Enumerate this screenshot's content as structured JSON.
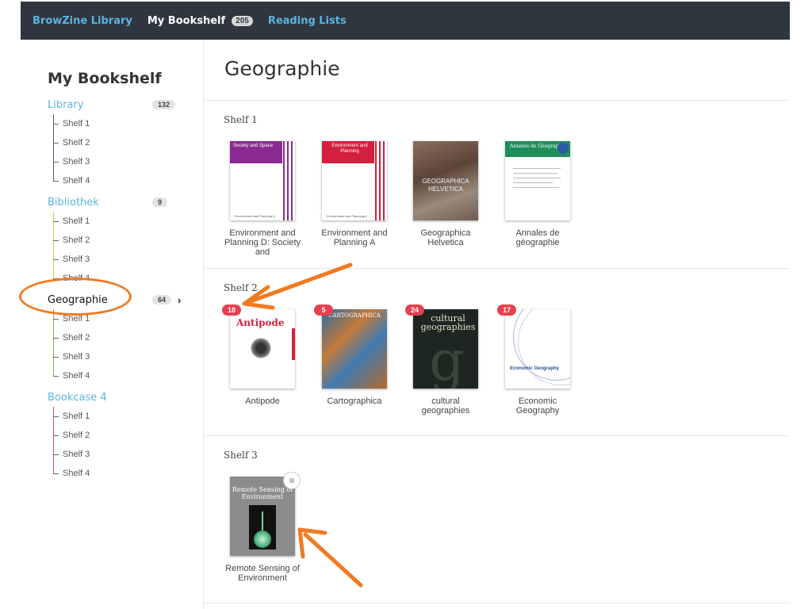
{
  "topbar": {
    "brand": "BrowZine Library",
    "my_bookshelf": "My Bookshelf",
    "my_bookshelf_count": "205",
    "reading_lists": "Reading Lists"
  },
  "sidebar": {
    "title": "My Bookshelf",
    "sections": [
      {
        "name": "Library",
        "count": "132",
        "shelves": [
          "Shelf 1",
          "Shelf 2",
          "Shelf 3",
          "Shelf 4"
        ]
      },
      {
        "name": "Bibliothek",
        "count": "9",
        "shelves": [
          "Shelf 1",
          "Shelf 2",
          "Shelf 3",
          "Shelf 4"
        ]
      },
      {
        "name": "Geographie",
        "count": "64",
        "shelves": [
          "Shelf 1",
          "Shelf 2",
          "Shelf 3",
          "Shelf 4"
        ]
      },
      {
        "name": "Bookcase 4",
        "shelves": [
          "Shelf 1",
          "Shelf 2",
          "Shelf 3",
          "Shelf 4"
        ]
      }
    ]
  },
  "main": {
    "title": "Geographie",
    "shelves": [
      {
        "label": "Shelf 1",
        "books": [
          {
            "title": "Environment and Planning D: Society and",
            "cover_text": "Society and Space",
            "cover_footer": "Environment and Planning D"
          },
          {
            "title": "Environment and Planning A",
            "cover_text": "Environment and Planning",
            "cover_footer": "Environment and Planning A"
          },
          {
            "title": "Geographica Helvetica",
            "cover_text": "GEOGRAPHICA HELVETICA"
          },
          {
            "title": "Annales de géographie",
            "cover_text": "Annales de Géographie"
          }
        ]
      },
      {
        "label": "Shelf 2",
        "books": [
          {
            "title": "Antipode",
            "badge": "18",
            "cover_text": "Antipode"
          },
          {
            "title": "Cartographica",
            "badge": "5",
            "cover_text": "CARTOGRAPHICA"
          },
          {
            "title": "cultural geographies",
            "badge": "24",
            "cover_text": "cultural geographies"
          },
          {
            "title": "Economic Geography",
            "badge": "17",
            "cover_text": "Economic Geography"
          }
        ]
      },
      {
        "label": "Shelf 3",
        "books": [
          {
            "title": "Remote Sensing of Environment",
            "cover_text": "Remote Sensing of Environment",
            "menu_icon": "≡"
          }
        ]
      }
    ]
  },
  "colors": {
    "topbar_bg": "#2f3640",
    "link_blue": "#5ab4e0",
    "badge_red": "#e8404f",
    "annotation_orange": "#f07a22",
    "tree_library": "#4a5a8a",
    "tree_bibliothek": "#e3c44a",
    "tree_geographie": "#6cb24a",
    "tree_bookcase4": "#d9506a"
  }
}
